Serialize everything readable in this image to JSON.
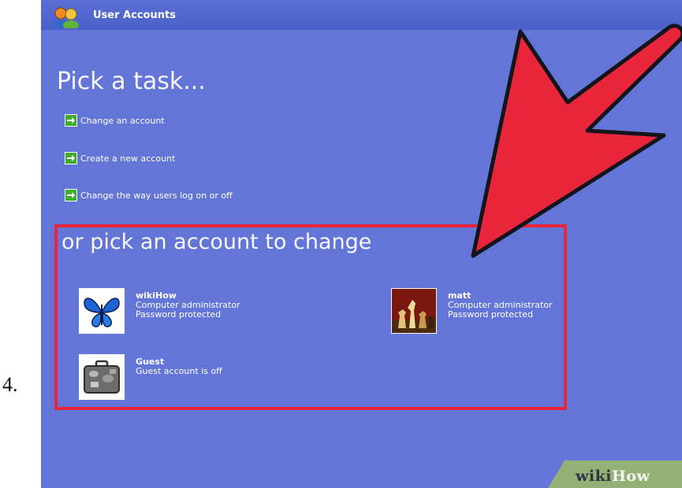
{
  "step": {
    "number": "4."
  },
  "window": {
    "title": "User Accounts"
  },
  "tasks": {
    "heading": "Pick a task...",
    "items": [
      {
        "label": "Change an account"
      },
      {
        "label": "Create a new account"
      },
      {
        "label": "Change the way users log on or off"
      }
    ]
  },
  "accounts": {
    "heading": "or pick an account to change",
    "items": [
      {
        "name": "wikiHow",
        "type": "Computer administrator",
        "status": "Password protected",
        "picture": "butterfly-icon"
      },
      {
        "name": "matt",
        "type": "Computer administrator",
        "status": "Password protected",
        "picture": "chess-icon"
      },
      {
        "name": "Guest",
        "type": "Guest account is off",
        "picture": "suitcase-icon"
      }
    ]
  },
  "watermark": {
    "wiki": "wiki",
    "how": "How"
  },
  "colors": {
    "background": "#6375d6",
    "highlight": "#e8253a",
    "arrow": "#e8253a",
    "task_arrow": "#3fae2a"
  }
}
